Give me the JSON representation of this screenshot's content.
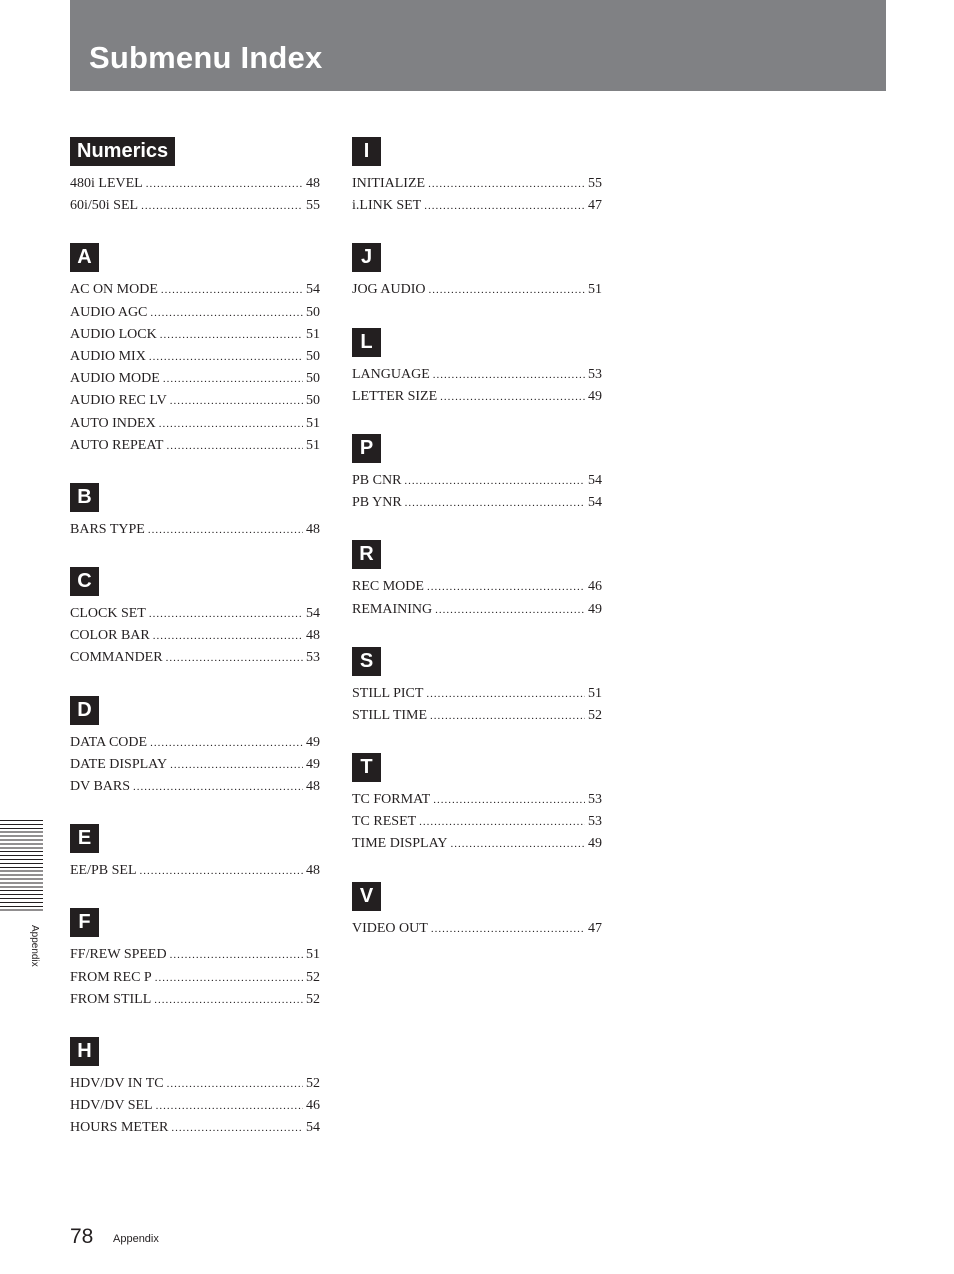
{
  "header": {
    "title": "Submenu Index"
  },
  "columns": [
    [
      {
        "letter": "Numerics",
        "entries": [
          {
            "name": "480i LEVEL",
            "page": "48"
          },
          {
            "name": "60i/50i SEL",
            "page": "55"
          }
        ]
      },
      {
        "letter": "A",
        "entries": [
          {
            "name": "AC ON MODE",
            "page": "54"
          },
          {
            "name": "AUDIO AGC",
            "page": "50"
          },
          {
            "name": "AUDIO LOCK",
            "page": "51"
          },
          {
            "name": "AUDIO MIX",
            "page": "50"
          },
          {
            "name": "AUDIO MODE",
            "page": "50"
          },
          {
            "name": "AUDIO REC LV",
            "page": "50"
          },
          {
            "name": "AUTO INDEX",
            "page": "51"
          },
          {
            "name": "AUTO REPEAT",
            "page": "51"
          }
        ]
      },
      {
        "letter": "B",
        "entries": [
          {
            "name": "BARS TYPE",
            "page": "48"
          }
        ]
      },
      {
        "letter": "C",
        "entries": [
          {
            "name": "CLOCK SET",
            "page": "54"
          },
          {
            "name": "COLOR BAR",
            "page": "48"
          },
          {
            "name": "COMMANDER",
            "page": "53"
          }
        ]
      },
      {
        "letter": "D",
        "entries": [
          {
            "name": "DATA CODE",
            "page": "49"
          },
          {
            "name": "DATE DISPLAY",
            "page": "49"
          },
          {
            "name": "DV BARS",
            "page": "48"
          }
        ]
      },
      {
        "letter": "E",
        "entries": [
          {
            "name": "EE/PB SEL",
            "page": "48"
          }
        ]
      },
      {
        "letter": "F",
        "entries": [
          {
            "name": "FF/REW SPEED",
            "page": "51"
          },
          {
            "name": "FROM REC P",
            "page": "52"
          },
          {
            "name": "FROM STILL",
            "page": "52"
          }
        ]
      },
      {
        "letter": "H",
        "entries": [
          {
            "name": "HDV/DV IN TC",
            "page": "52"
          },
          {
            "name": "HDV/DV SEL",
            "page": "46"
          },
          {
            "name": "HOURS METER",
            "page": "54"
          }
        ]
      }
    ],
    [
      {
        "letter": "I",
        "entries": [
          {
            "name": "INITIALIZE",
            "page": "55"
          },
          {
            "name": "i.LINK SET",
            "page": "47"
          }
        ]
      },
      {
        "letter": "J",
        "entries": [
          {
            "name": "JOG AUDIO",
            "page": "51"
          }
        ]
      },
      {
        "letter": "L",
        "entries": [
          {
            "name": "LANGUAGE",
            "page": "53"
          },
          {
            "name": "LETTER SIZE",
            "page": "49"
          }
        ]
      },
      {
        "letter": "P",
        "entries": [
          {
            "name": "PB CNR",
            "page": "54"
          },
          {
            "name": "PB YNR",
            "page": "54"
          }
        ]
      },
      {
        "letter": "R",
        "entries": [
          {
            "name": "REC MODE",
            "page": "46"
          },
          {
            "name": "REMAINING",
            "page": "49"
          }
        ]
      },
      {
        "letter": "S",
        "entries": [
          {
            "name": "STILL PICT",
            "page": "51"
          },
          {
            "name": "STILL TIME",
            "page": "52"
          }
        ]
      },
      {
        "letter": "T",
        "entries": [
          {
            "name": "TC FORMAT",
            "page": "53"
          },
          {
            "name": "TC RESET",
            "page": "53"
          },
          {
            "name": "TIME DISPLAY",
            "page": "49"
          }
        ]
      },
      {
        "letter": "V",
        "entries": [
          {
            "name": "VIDEO OUT",
            "page": "47"
          }
        ]
      }
    ]
  ],
  "side_tab": {
    "label": "Appendix"
  },
  "footer": {
    "page_number": "78",
    "section": "Appendix"
  }
}
